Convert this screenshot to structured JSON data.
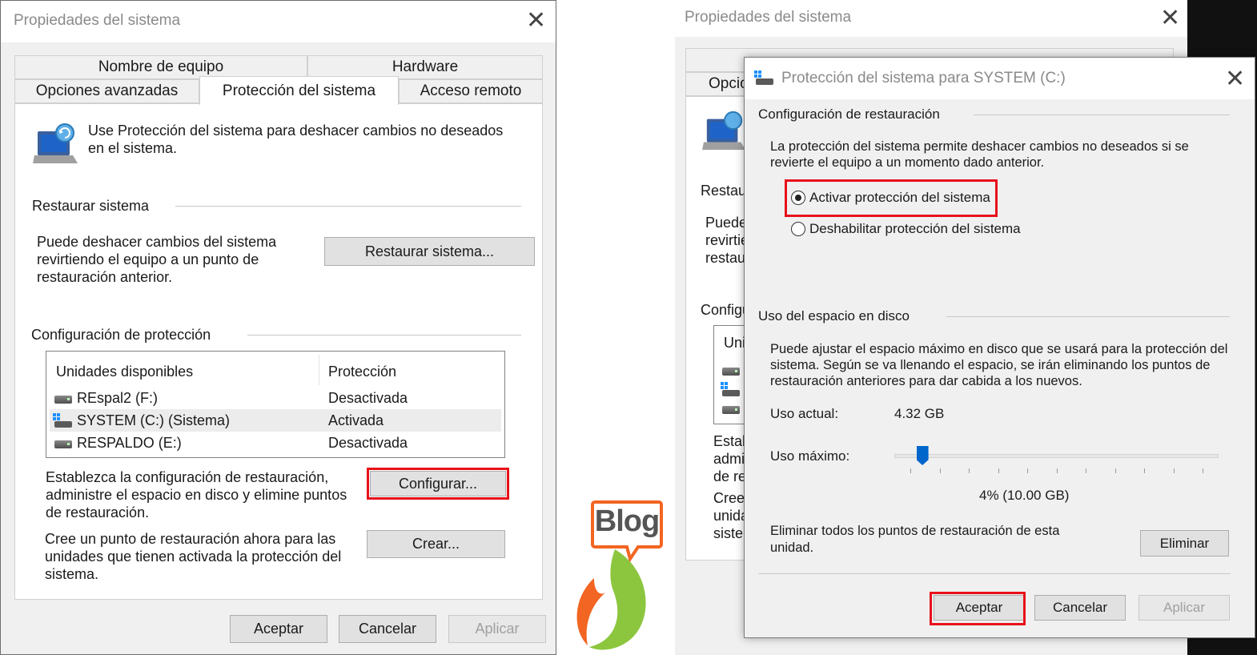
{
  "left_dialog": {
    "title": "Propiedades del sistema",
    "tabs_row1": [
      "Nombre de equipo",
      "Hardware"
    ],
    "tabs_row2": [
      "Opciones avanzadas",
      "Protección del sistema",
      "Acceso remoto"
    ],
    "intro": "Use Protección del sistema para deshacer cambios no deseados en el sistema.",
    "restore_heading": "Restaurar sistema",
    "restore_text": "Puede deshacer cambios del sistema revirtiendo el equipo a un punto de restauración anterior.",
    "restore_button": "Restaurar sistema...",
    "config_heading": "Configuración de protección",
    "list_headers": {
      "drives": "Unidades disponibles",
      "protection": "Protección"
    },
    "drives": [
      {
        "name": "REspal2 (F:)",
        "protection": "Desactivada"
      },
      {
        "name": "SYSTEM (C:) (Sistema)",
        "protection": "Activada"
      },
      {
        "name": "RESPALDO (E:)",
        "protection": "Desactivada"
      }
    ],
    "configure_text": "Establezca la configuración de restauración, administre el espacio en disco y elimine puntos de restauración.",
    "configure_button": "Configurar...",
    "create_text": "Cree un punto de restauración ahora para las unidades que tienen activada la protección del sistema.",
    "create_button": "Crear...",
    "ok_button": "Aceptar",
    "cancel_button": "Cancelar",
    "apply_button": "Aplicar"
  },
  "back_dialog": {
    "title": "Propiedades del sistema",
    "tab_partial": "Opcio",
    "restore_partial": "Restau",
    "puede_lines": [
      "Puede",
      "revirtie",
      "restaur"
    ],
    "config_partial": "Configu",
    "list_partial": "Uni",
    "estab_lines": [
      "Estab",
      "admin",
      "de re"
    ],
    "cree_lines": [
      "Cree",
      "unida",
      "sisten"
    ]
  },
  "right_dialog": {
    "title": "Protección del sistema para SYSTEM (C:)",
    "restore_settings_heading": "Configuración de restauración",
    "restore_settings_text": "La protección del sistema permite deshacer cambios no deseados si se revierte el equipo a un momento dado anterior.",
    "radio_enable": "Activar protección del sistema",
    "radio_disable": "Deshabilitar protección del sistema",
    "disk_heading": "Uso del espacio en disco",
    "disk_text": "Puede ajustar el espacio máximo en disco que se usará para la protección del sistema. Según se va llenando el espacio, se irán eliminando los puntos de restauración anteriores para dar cabida a los nuevos.",
    "current_usage_label": "Uso actual:",
    "current_usage_value": "4.32 GB",
    "max_usage_label": "Uso máximo:",
    "max_usage_percent": 4,
    "max_usage_value": "4% (10.00 GB)",
    "delete_text": "Eliminar todos los puntos de restauración de esta unidad.",
    "delete_button": "Eliminar",
    "ok_button": "Aceptar",
    "cancel_button": "Cancelar",
    "apply_button": "Aplicar"
  },
  "logo": {
    "text": "Blog"
  },
  "colors": {
    "highlight": "#e8101a",
    "slider_thumb": "#0066cc",
    "logo_orange": "#f26522",
    "logo_green": "#8cc63f"
  }
}
